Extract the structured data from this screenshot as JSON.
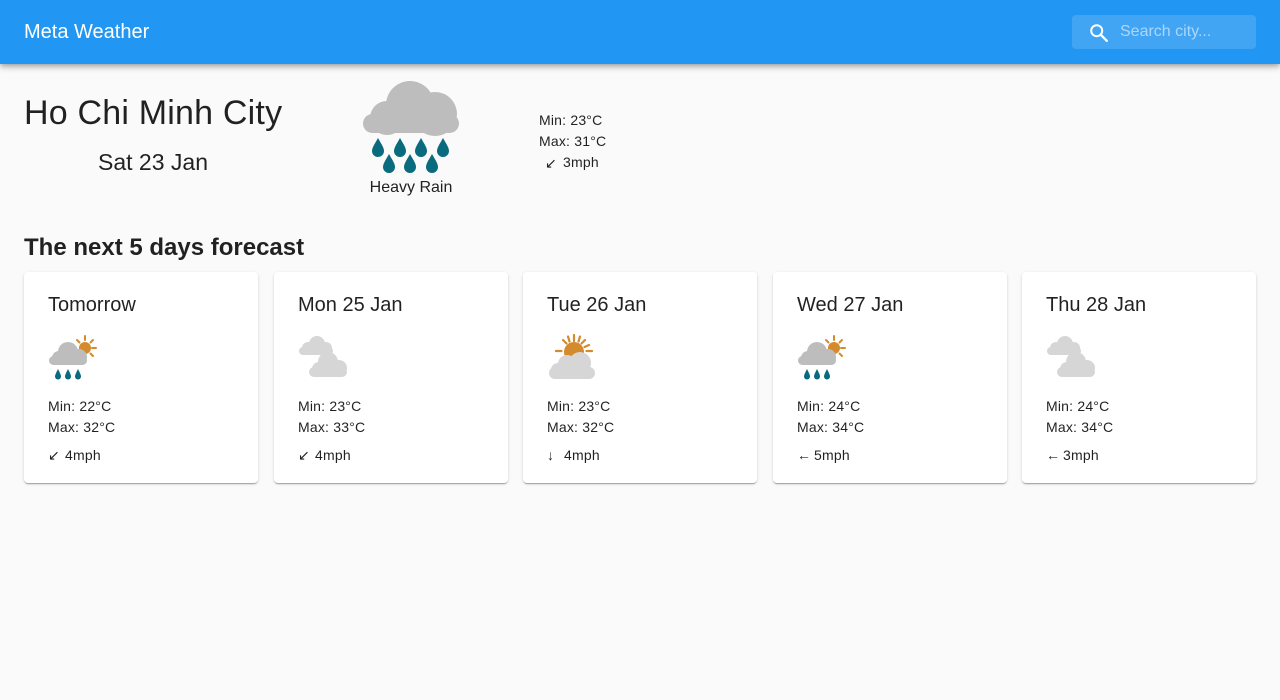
{
  "app": {
    "title": "Meta Weather",
    "search": {
      "placeholder": "Search city...",
      "value": "",
      "icon": "search-icon"
    }
  },
  "current": {
    "city": "Ho Chi Minh City",
    "date": "Sat 23 Jan",
    "condition": "Heavy Rain",
    "icon": "heavy-rain-icon",
    "min": "Min: 23°C",
    "max": "Max: 31°C",
    "wind_arrow": "↙",
    "wind": "3mph"
  },
  "forecast": {
    "title": "The next 5 days forecast",
    "days": [
      {
        "day": "Tomorrow",
        "icon": "light-rain-icon",
        "min": "Min: 22°C",
        "max": "Max: 32°C",
        "wind_arrow": "↙",
        "wind": "4mph"
      },
      {
        "day": "Mon 25 Jan",
        "icon": "heavy-cloud-icon",
        "min": "Min: 23°C",
        "max": "Max: 33°C",
        "wind_arrow": "↙",
        "wind": "4mph"
      },
      {
        "day": "Tue 26 Jan",
        "icon": "light-cloud-icon",
        "min": "Min: 23°C",
        "max": "Max: 32°C",
        "wind_arrow": "↓",
        "wind": "4mph"
      },
      {
        "day": "Wed 27 Jan",
        "icon": "light-rain-icon",
        "min": "Min: 24°C",
        "max": "Max: 34°C",
        "wind_arrow": "←",
        "wind": "5mph"
      },
      {
        "day": "Thu 28 Jan",
        "icon": "heavy-cloud-icon",
        "min": "Min: 24°C",
        "max": "Max: 34°C",
        "wind_arrow": "←",
        "wind": "3mph"
      }
    ]
  },
  "colors": {
    "appbar": "#2196f3",
    "background": "#fafafa",
    "cloud": "#bdbdbd",
    "cloud_light": "#d6d6d6",
    "rain": "#0a6a7e",
    "sun": "#d38b2d"
  }
}
